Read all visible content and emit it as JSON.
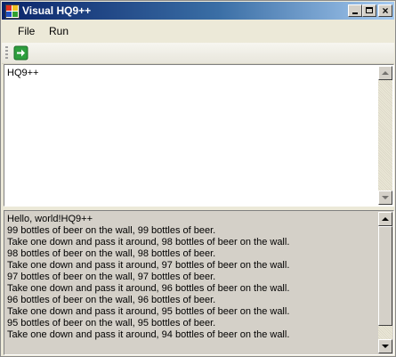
{
  "window": {
    "title": "Visual HQ9++"
  },
  "menu": {
    "items": [
      "File",
      "Run"
    ]
  },
  "toolbar": {
    "run_icon": "green-arrow-run-icon"
  },
  "editor": {
    "code": "HQ9++"
  },
  "output": {
    "lines": [
      "Hello, world!HQ9++",
      "99 bottles of beer on the wall, 99 bottles of beer.",
      "Take one down and pass it around, 98 bottles of beer on the wall.",
      "98 bottles of beer on the wall, 98 bottles of beer.",
      "Take one down and pass it around, 97 bottles of beer on the wall.",
      "97 bottles of beer on the wall, 97 bottles of beer.",
      "Take one down and pass it around, 96 bottles of beer on the wall.",
      "96 bottles of beer on the wall, 96 bottles of beer.",
      "Take one down and pass it around, 95 bottles of beer on the wall.",
      "95 bottles of beer on the wall, 95 bottles of beer.",
      "Take one down and pass it around, 94 bottles of beer on the wall."
    ]
  },
  "colors": {
    "titlebar_start": "#0a246a",
    "run_icon": "#2e9e3e",
    "window_face": "#ece9d8",
    "output_background": "#d4d0c8"
  }
}
